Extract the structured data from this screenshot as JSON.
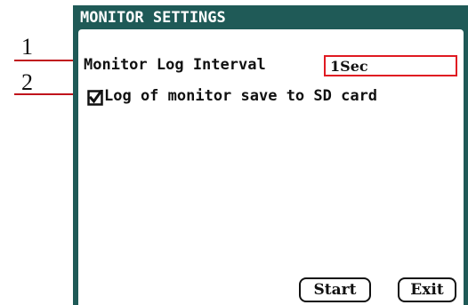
{
  "window": {
    "title": "MONITOR SETTINGS"
  },
  "annotations": {
    "callout_1": "1",
    "callout_2": "2"
  },
  "settings": {
    "log_interval": {
      "label": "Monitor Log Interval",
      "value": "1Sec"
    },
    "save_to_sd": {
      "label": "Log of monitor save to SD card",
      "checked": true
    }
  },
  "buttons": {
    "start": "Start",
    "exit": "Exit"
  },
  "colors": {
    "title_bar": "#1f5a57",
    "highlight_border": "#e01a22",
    "callout_line": "#c0141c"
  }
}
